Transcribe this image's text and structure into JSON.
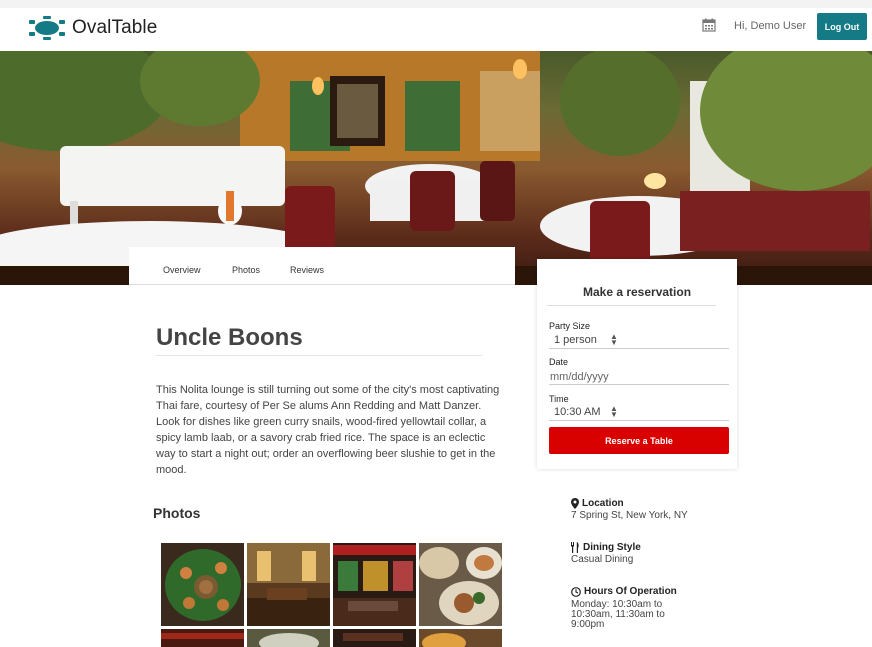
{
  "brand": {
    "name": "OvalTable",
    "accent": "#147a85"
  },
  "header": {
    "calendar_icon": "calendar-icon",
    "greeting": "Hi, Demo User",
    "logout_label": "Log Out"
  },
  "tabs": [
    {
      "label": "Overview"
    },
    {
      "label": "Photos"
    },
    {
      "label": "Reviews"
    }
  ],
  "restaurant": {
    "name": "Uncle Boons",
    "description": "This Nolita lounge is still turning out some of the city's most captivating Thai fare, courtesy of Per Se alums Ann Redding and Matt Danzer. Look for dishes like green curry snails, wood-fired yellowtail collar, a spicy lamb laab, or a savory crab fried rice. The space is an eclectic way to start a night out; order an overflowing beer slushie to get in the mood."
  },
  "photos": {
    "heading": "Photos"
  },
  "reservation": {
    "title": "Make a reservation",
    "party_label": "Party Size",
    "party_value": "1 person",
    "date_label": "Date",
    "date_placeholder": "mm/dd/yyyy",
    "time_label": "Time",
    "time_value": "10:30 AM",
    "button_label": "Reserve a Table",
    "button_color": "#d90000"
  },
  "info": {
    "location_label": "Location",
    "location_value": "7 Spring St, New York, NY",
    "style_label": "Dining Style",
    "style_value": "Casual Dining",
    "hours_label": "Hours Of Operation",
    "hours_line1": "Monday: 10:30am to",
    "hours_line2": "10:30am, 11:30am to",
    "hours_line3": "9:00pm"
  }
}
